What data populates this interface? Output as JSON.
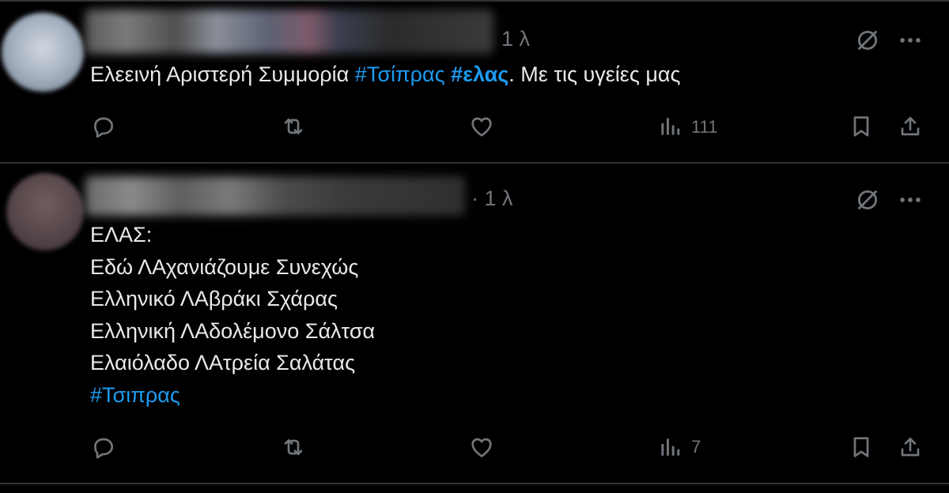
{
  "tweets": [
    {
      "timestamp": "1 λ",
      "text_plain": "Ελεεινή Αριστερή Συμμορία ",
      "hashtag_1": "#Τσίπρας",
      "hashtag_2": "#ελας",
      "text_after": ". Με τις υγείες μας",
      "views": "111",
      "icons": {
        "reply": "reply-icon",
        "retweet": "retweet-icon",
        "like": "heart-icon",
        "views": "views-chart-icon",
        "bookmark": "bookmark-icon",
        "share": "share-icon",
        "grok": "grok-icon",
        "more": "more-icon"
      }
    },
    {
      "timestamp": "· 1 λ",
      "lines": [
        "ΕΛΑΣ:",
        "Εδώ ΛΑχανιάζουμε Συνεχώς",
        "Ελληνικό ΛΑβράκι Σχάρας",
        "Ελληνική ΛΑδολέμονο Σάλτσα",
        "Ελαιόλαδο ΛΑτρεία Σαλάτας"
      ],
      "hashtag": " #Τσιπρας",
      "views": "7"
    }
  ],
  "colors": {
    "background": "#000000",
    "text": "#e7e9ea",
    "secondary": "#71767b",
    "accent": "#1d9bf0",
    "divider": "#2f3336"
  }
}
